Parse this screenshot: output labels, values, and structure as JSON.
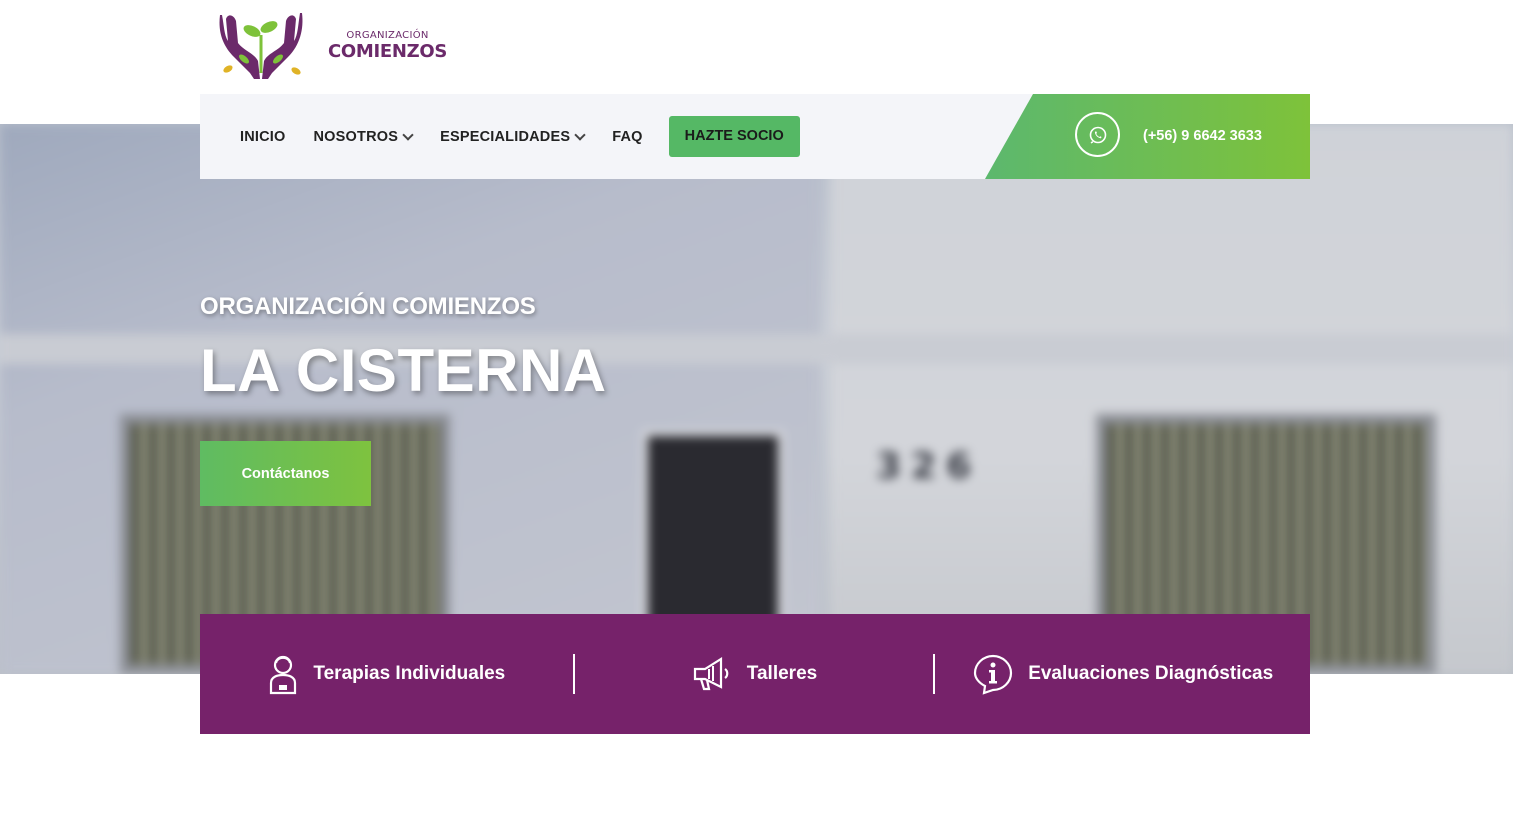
{
  "brand": {
    "small": "ORGANIZACIÓN",
    "big": "COMIENZOS",
    "colors": {
      "purple": "#6b2a6a",
      "green": "#7ec23a",
      "leaf_yellow": "#e0b326"
    }
  },
  "nav": {
    "items": [
      {
        "label": "INICIO",
        "dropdown": false
      },
      {
        "label": "NOSOTROS",
        "dropdown": true
      },
      {
        "label": "ESPECIALIDADES",
        "dropdown": true
      },
      {
        "label": "FAQ",
        "dropdown": false
      }
    ],
    "cta": "HAZTE SOCIO",
    "phone": "(+56) 9 6642 3633",
    "phone_icon": "whatsapp-icon"
  },
  "hero": {
    "subtitle": "ORGANIZACIÓN COMIENZOS",
    "title": "LA CISTERNA",
    "button": "Contáctanos",
    "house_number": "326"
  },
  "services": [
    {
      "label": "Terapias Individuales",
      "icon": "person-icon"
    },
    {
      "label": "Talleres",
      "icon": "megaphone-icon"
    },
    {
      "label": "Evaluaciones Diagnósticas",
      "icon": "info-icon"
    }
  ],
  "colors": {
    "nav_bg": "#f4f5f9",
    "cta_green": "#55b865",
    "services_bg": "#76226a"
  }
}
